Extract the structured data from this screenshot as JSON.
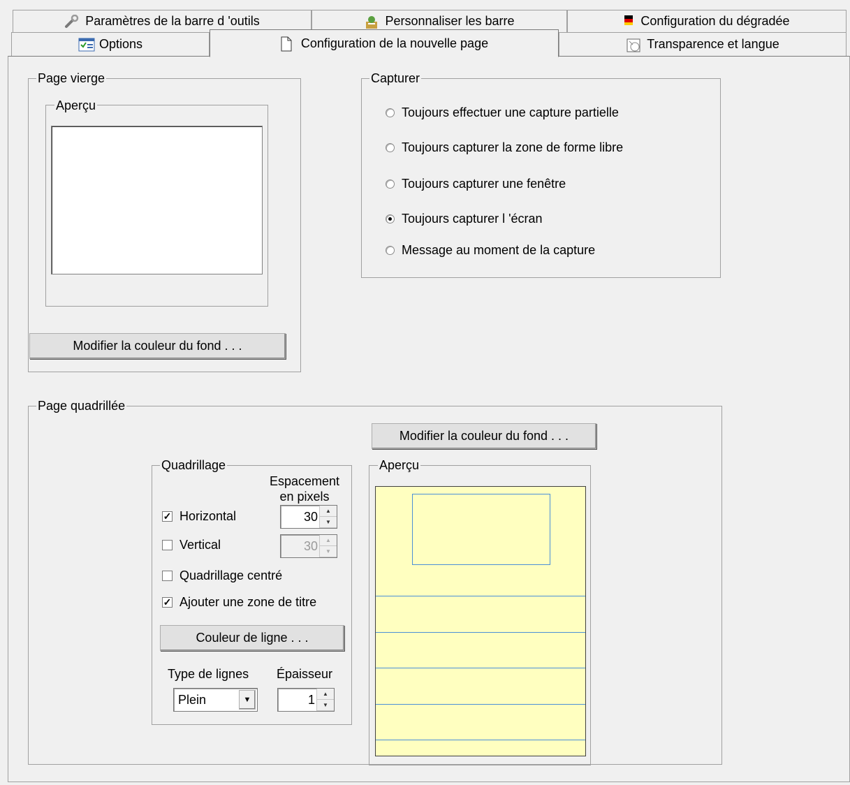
{
  "tabs": {
    "row1": [
      {
        "label": "Paramètres de la barre d 'outils",
        "icon": "wrench-icon"
      },
      {
        "label": "Personnaliser les barre",
        "icon": "paint-icon"
      },
      {
        "label": "Configuration du dégradée",
        "icon": "flag-icon"
      }
    ],
    "row2": [
      {
        "label": "Options",
        "icon": "options-icon"
      },
      {
        "label": "Configuration de la nouvelle page",
        "icon": "page-icon",
        "active": true
      },
      {
        "label": "Transparence et langue",
        "icon": "transparency-icon"
      }
    ]
  },
  "blank_page": {
    "title": "Page vierge",
    "preview_title": "Aperçu",
    "bg_button": "Modifier la couleur du fond . . ."
  },
  "capture": {
    "title": "Capturer",
    "options": [
      {
        "label": "Toujours effectuer une capture partielle",
        "selected": false
      },
      {
        "label": "Toujours capturer la zone de forme libre",
        "selected": false
      },
      {
        "label": "Toujours capturer une fenêtre",
        "selected": false
      },
      {
        "label": "Toujours capturer l 'écran",
        "selected": true
      },
      {
        "label": "Message au moment de la capture",
        "selected": false
      }
    ]
  },
  "grid_page": {
    "title": "Page quadrillée",
    "bg_button": "Modifier la couleur du fond . . .",
    "grid": {
      "title": "Quadrillage",
      "spacing_label_1": "Espacement",
      "spacing_label_2": "en pixels",
      "horizontal": {
        "label": "Horizontal",
        "checked": true,
        "value": "30"
      },
      "vertical": {
        "label": "Vertical",
        "checked": false,
        "value": "30"
      },
      "centered": {
        "label": "Quadrillage centré",
        "checked": false
      },
      "title_zone": {
        "label": "Ajouter une zone de titre",
        "checked": true
      },
      "line_color_button": "Couleur de ligne . . .",
      "line_type_label": "Type de lignes",
      "line_type_value": "Plein",
      "thickness_label": "Épaisseur",
      "thickness_value": "1"
    },
    "preview": {
      "title": "Aperçu",
      "background": "#ffffc0",
      "line_color": "#4a8fd8"
    }
  }
}
